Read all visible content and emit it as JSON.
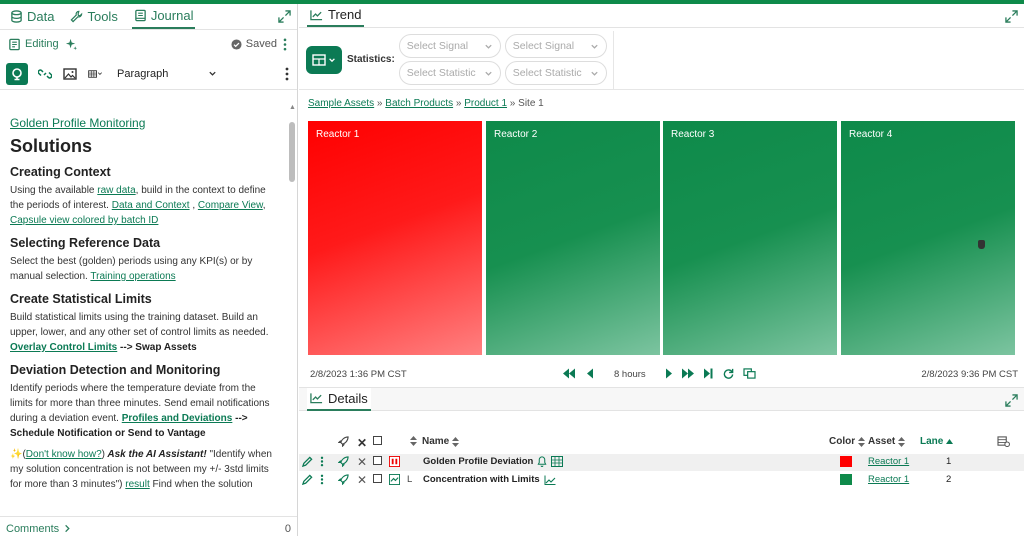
{
  "left_panel": {
    "tabs": [
      {
        "label": "Data",
        "icon": "database-icon"
      },
      {
        "label": "Tools",
        "icon": "wrench-icon"
      },
      {
        "label": "Journal",
        "icon": "journal-icon",
        "active": true
      }
    ],
    "editing_label": "Editing",
    "saved_label": "Saved",
    "paragraph_style": "Paragraph",
    "comments_label": "Comments",
    "comments_count": "0"
  },
  "journal": {
    "top_link": "Golden Profile Monitoring",
    "title": "Solutions",
    "sections": [
      {
        "heading": "Creating Context",
        "p_prefix": "Using the available ",
        "link1": "raw data",
        "p_mid": ", build in the context to define the periods of interest. ",
        "link2": "Data and Context",
        "sep1": " , ",
        "link3": "Compare View",
        "sep2": ", ",
        "link4": "Capsule view colored by batch ID"
      },
      {
        "heading": "Selecting Reference Data",
        "p_prefix": "Select the best (golden) periods using any KPI(s) or by manual selection. ",
        "link1": "Training operations"
      },
      {
        "heading": "Create Statistical Limits",
        "p_prefix": "Build statistical limits using the training dataset. Build an upper, lower, and any other set of control limits as needed. ",
        "link1": "Overlay Control Limits",
        "bold_suffix": " --> Swap Assets"
      },
      {
        "heading": "Deviation Detection and Monitoring",
        "p_prefix": "Identify periods where the temperature deviate from the limits for more than three minutes. Send email notifications during a deviation event. ",
        "link1": "Profiles and Deviations",
        "bold_suffix": " --> Schedule Notification or Send to Vantage"
      }
    ],
    "ai_emoji": "✨",
    "ai_link": "Don't know how?",
    "ai_bold": " Ask the AI Assistant!",
    "ai_text": " \"Identify when my solution concentration is not between my +/- 3std limits for more than 3 minutes\")",
    "ai_result": "result",
    "ai_tail": " Find when the solution"
  },
  "trend": {
    "title": "Trend",
    "statistics_label": "Statistics:",
    "select_signal_1": "Select Signal",
    "select_signal_2": "Select Signal",
    "select_statistic_1": "Select Statistic",
    "select_statistic_2": "Select Statistic",
    "breadcrumb": [
      "Sample Assets",
      "Batch Products",
      "Product 1",
      "Site 1"
    ],
    "tiles": [
      {
        "label": "Reactor 1",
        "color": "#ff0000"
      },
      {
        "label": "Reactor 2",
        "color": "#0e8a4a"
      },
      {
        "label": "Reactor 3",
        "color": "#0e8a4a"
      },
      {
        "label": "Reactor 4",
        "color": "#0e8a4a"
      }
    ],
    "start_time": "2/8/2023 1:36 PM  CST",
    "end_time": "2/8/2023 9:36 PM  CST",
    "duration": "8 hours"
  },
  "details": {
    "title": "Details",
    "columns": {
      "name": "Name",
      "color": "Color",
      "asset": "Asset",
      "lane": "Lane"
    },
    "rows": [
      {
        "name": "Golden Profile Deviation",
        "color": "#ff0000",
        "asset": "Reactor 1",
        "lane": "1",
        "axis": ""
      },
      {
        "name": "Concentration with Limits",
        "color": "#0e8a4a",
        "asset": "Reactor 1",
        "lane": "2",
        "axis": "L"
      }
    ]
  }
}
